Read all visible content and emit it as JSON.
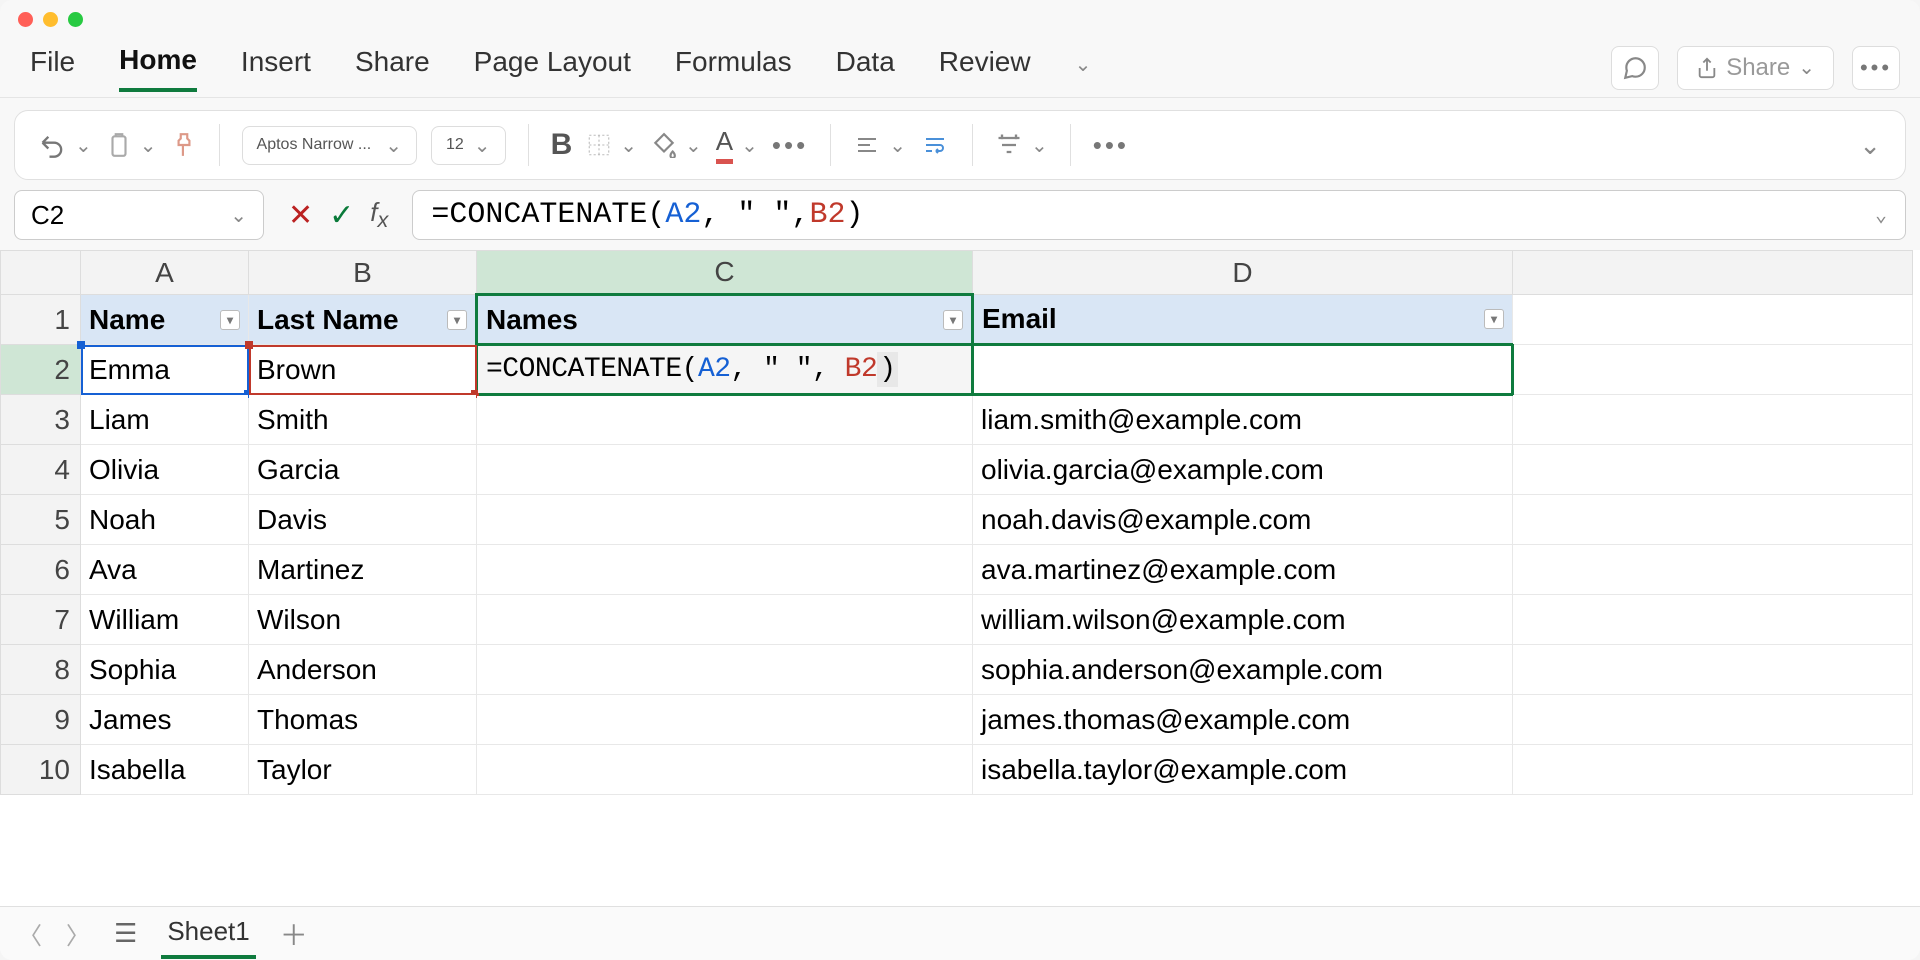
{
  "menu": {
    "file": "File",
    "home": "Home",
    "insert": "Insert",
    "share": "Share",
    "page_layout": "Page Layout",
    "formulas": "Formulas",
    "data": "Data",
    "review": "Review",
    "share_btn": "Share"
  },
  "ribbon": {
    "font": "Aptos Narrow ...",
    "size": "12",
    "bold": "B"
  },
  "namebox": "C2",
  "formula": {
    "prefix": "=CONCATENATE(",
    "a2": "A2",
    "mid": ", \" \", ",
    "b2": "B2",
    "suffix": ")"
  },
  "columns": {
    "A": "A",
    "B": "B",
    "C": "C",
    "D": "D"
  },
  "headers": {
    "name": "Name",
    "last": "Last Name",
    "names": "Names",
    "email": "Email"
  },
  "rows": [
    {
      "n": "2",
      "first": "Emma",
      "last": "Brown",
      "email": ""
    },
    {
      "n": "3",
      "first": "Liam",
      "last": "Smith",
      "email": "liam.smith@example.com"
    },
    {
      "n": "4",
      "first": "Olivia",
      "last": "Garcia",
      "email": "olivia.garcia@example.com"
    },
    {
      "n": "5",
      "first": "Noah",
      "last": "Davis",
      "email": "noah.davis@example.com"
    },
    {
      "n": "6",
      "first": "Ava",
      "last": "Martinez",
      "email": "ava.martinez@example.com"
    },
    {
      "n": "7",
      "first": "William",
      "last": "Wilson",
      "email": "william.wilson@example.com"
    },
    {
      "n": "8",
      "first": "Sophia",
      "last": "Anderson",
      "email": "sophia.anderson@example.com"
    },
    {
      "n": "9",
      "first": "James",
      "last": "Thomas",
      "email": "james.thomas@example.com"
    },
    {
      "n": "10",
      "first": "Isabella",
      "last": "Taylor",
      "email": "isabella.taylor@example.com"
    }
  ],
  "sheet": "Sheet1"
}
